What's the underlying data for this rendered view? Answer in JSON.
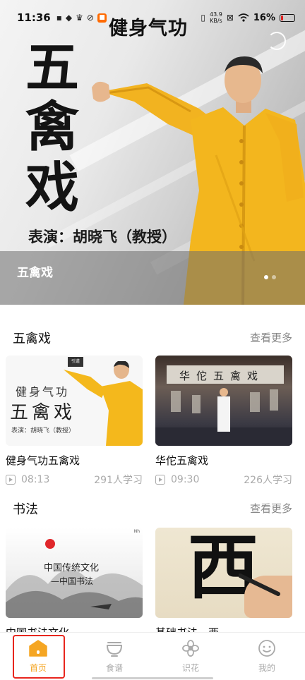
{
  "status_bar": {
    "time": "11:36",
    "net_speed_value": "43.9",
    "net_speed_unit": "KB/s",
    "battery": "16%",
    "left_icons": [
      "sim-icon",
      "notification-icon",
      "crown-icon",
      "refresh-app-icon",
      "app-badge-icon"
    ],
    "right_icons": [
      "vibrate-icon",
      "net-speed-icon",
      "close-box-icon",
      "wifi-icon",
      "battery-icon"
    ]
  },
  "hero": {
    "app_title": "健身气功",
    "big_chars": [
      "五",
      "禽",
      "戏"
    ],
    "performer": "表演：胡晓飞（教授）",
    "caption": "五禽戏",
    "slide_count": 2,
    "active_slide": 1
  },
  "sections": [
    {
      "title": "五禽戏",
      "see_more": "查看更多",
      "cards": [
        {
          "title": "健身气功五禽戏",
          "duration": "08:13",
          "learners": "291人学习",
          "thumb": {
            "logo": "引道",
            "line1": "健身气功",
            "line2": "五禽戏",
            "line3": "表演：胡晓飞（教授）"
          }
        },
        {
          "title": "华佗五禽戏",
          "duration": "09:30",
          "learners": "226人学习",
          "thumb": {
            "banner": "华佗五禽戏"
          }
        }
      ]
    },
    {
      "title": "书法",
      "see_more": "查看更多",
      "cards": [
        {
          "title": "中国书法文化",
          "thumb": {
            "line1": "中国传统文化",
            "line2": "—中国书法",
            "corner": "Nh"
          }
        },
        {
          "title": "基础书法—西",
          "thumb": {
            "char": "西"
          }
        }
      ]
    }
  ],
  "bottom_nav": {
    "items": [
      {
        "label": "首页",
        "icon": "home-icon",
        "active": true
      },
      {
        "label": "食谱",
        "icon": "bowl-icon",
        "active": false
      },
      {
        "label": "识花",
        "icon": "flower-icon",
        "active": false
      },
      {
        "label": "我的",
        "icon": "profile-icon",
        "active": false
      }
    ]
  },
  "colors": {
    "accent": "#f5a623",
    "highlight_box": "#e8261d",
    "muted_text": "#888888"
  }
}
